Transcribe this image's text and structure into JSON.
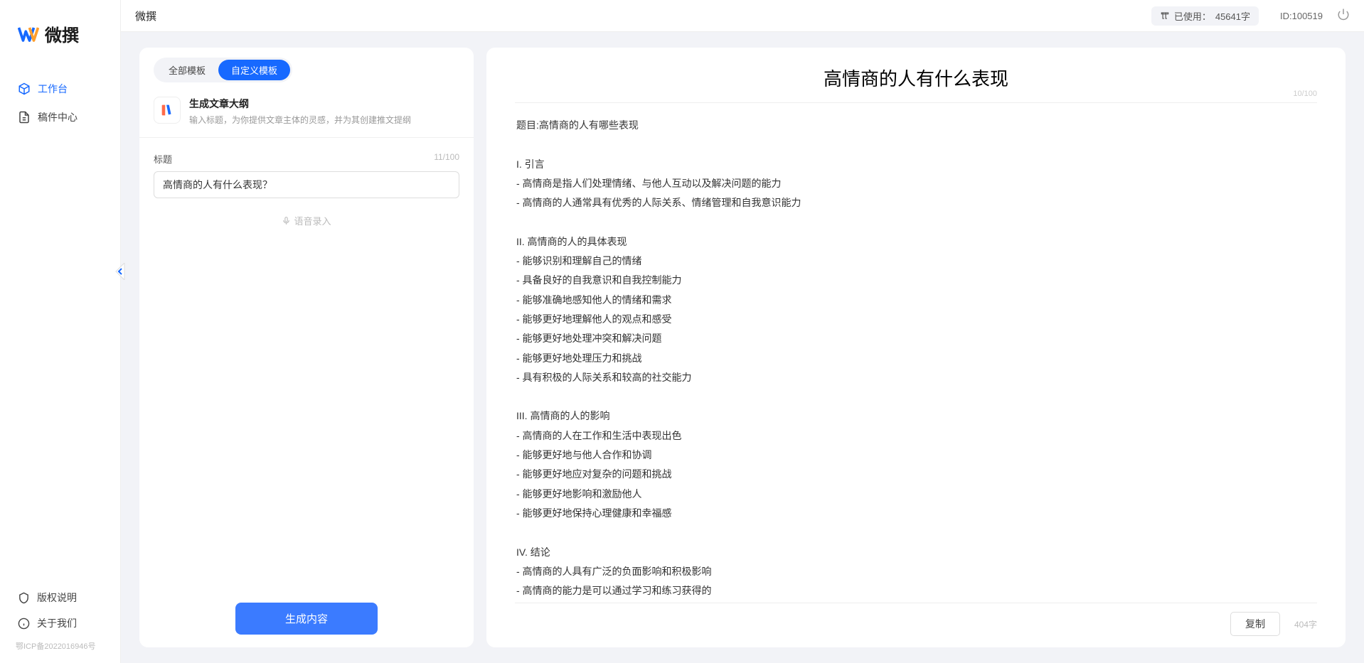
{
  "app_name": "微撰",
  "topbar": {
    "title": "微撰",
    "usage_label": "已使用：",
    "usage_value": "45641字",
    "id_label": "ID:100519"
  },
  "sidebar": {
    "nav": [
      {
        "label": "工作台",
        "active": true
      },
      {
        "label": "稿件中心",
        "active": false
      }
    ],
    "bottom": [
      {
        "label": "版权说明"
      },
      {
        "label": "关于我们"
      }
    ],
    "icp": "鄂ICP备2022016946号"
  },
  "left": {
    "tabs": [
      {
        "label": "全部模板",
        "active": false
      },
      {
        "label": "自定义模板",
        "active": true
      }
    ],
    "template": {
      "title": "生成文章大纲",
      "desc": "输入标题，为你提供文章主体的灵感，并为其创建推文提纲"
    },
    "field": {
      "label": "标题",
      "count": "11/100",
      "value": "高情商的人有什么表现？"
    },
    "voice_link": "语音录入",
    "generate_btn": "生成内容"
  },
  "right": {
    "title": "高情商的人有什么表现",
    "meta": "10/100",
    "body": "题目:高情商的人有哪些表现\n\nI. 引言\n- 高情商是指人们处理情绪、与他人互动以及解决问题的能力\n- 高情商的人通常具有优秀的人际关系、情绪管理和自我意识能力\n\nII. 高情商的人的具体表现\n- 能够识别和理解自己的情绪\n- 具备良好的自我意识和自我控制能力\n- 能够准确地感知他人的情绪和需求\n- 能够更好地理解他人的观点和感受\n- 能够更好地处理冲突和解决问题\n- 能够更好地处理压力和挑战\n- 具有积极的人际关系和较高的社交能力\n\nIII. 高情商的人的影响\n- 高情商的人在工作和生活中表现出色\n- 能够更好地与他人合作和协调\n- 能够更好地应对复杂的问题和挑战\n- 能够更好地影响和激励他人\n- 能够更好地保持心理健康和幸福感\n\nIV. 结论\n- 高情商的人具有广泛的负面影响和积极影响\n- 高情商的能力是可以通过学习和练习获得的\n- 培养和提高高情商的能力对于个人的职业发展和生活质量至关重要。",
    "copy_btn": "复制",
    "char_cnt": "404字"
  }
}
